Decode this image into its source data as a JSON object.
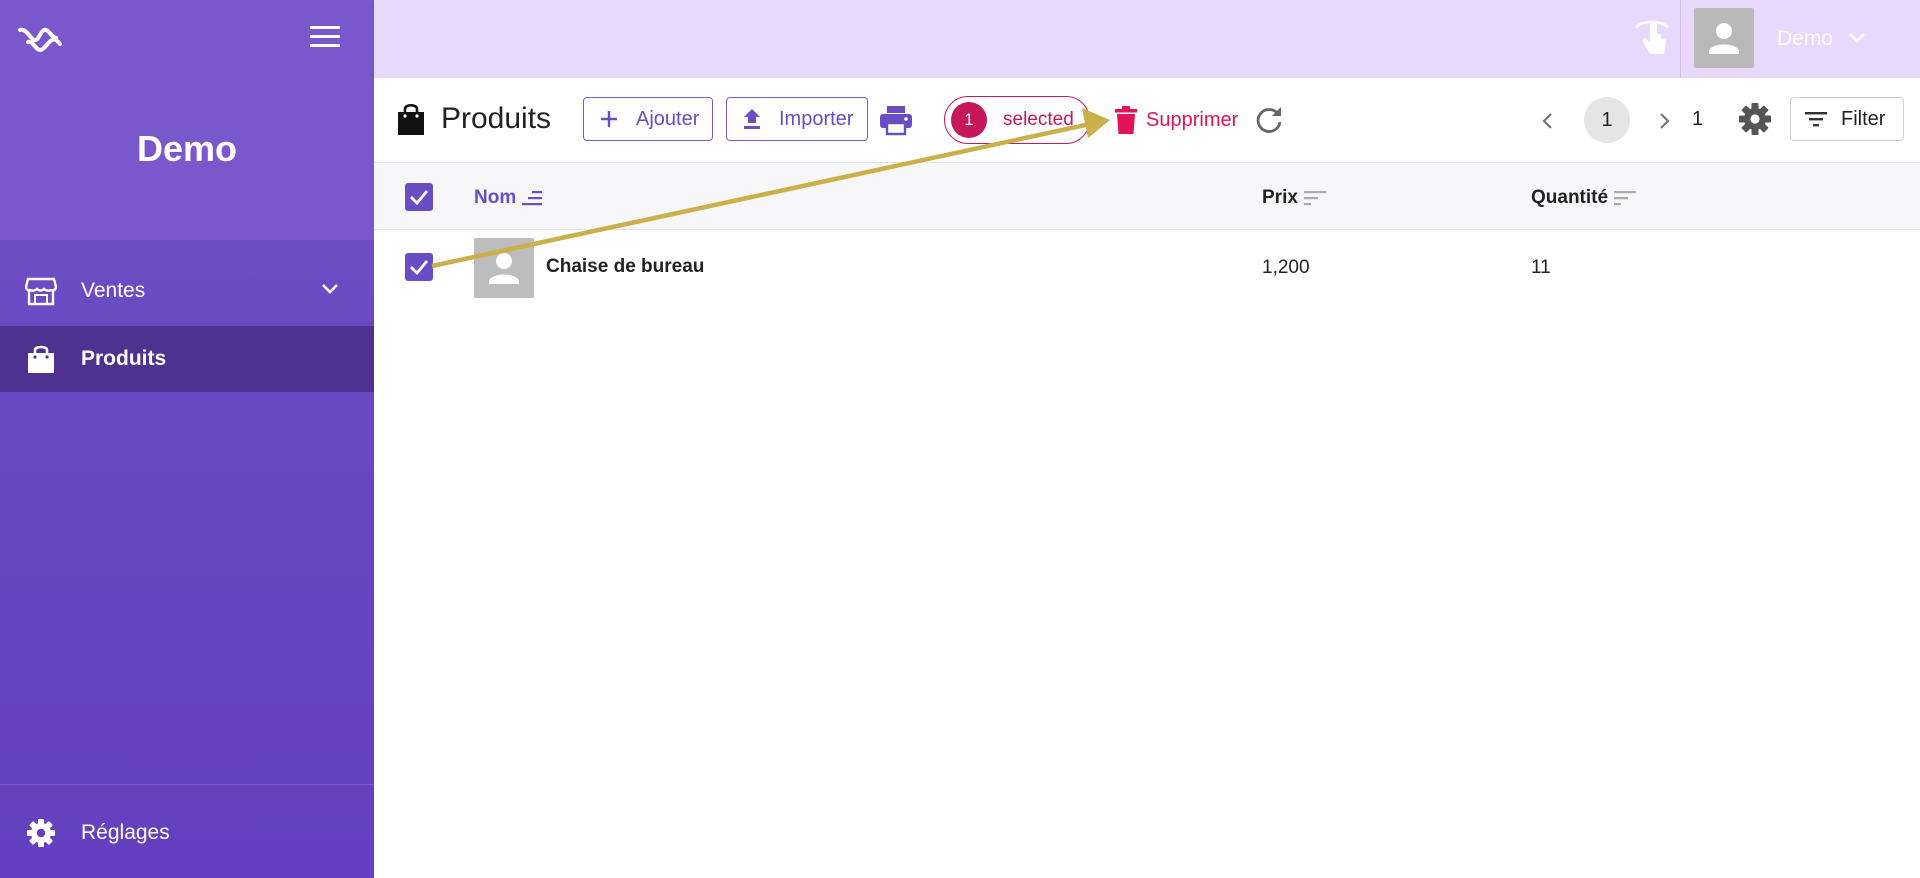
{
  "app": {
    "title": "Demo",
    "accent_color": "#6a4cc4",
    "sidebar_color": "#7a58cc",
    "topbar_color": "#e8d8fc",
    "danger_color": "#e11459"
  },
  "sidebar": {
    "logo_icon": "brand-logo-icon",
    "menu_icon": "hamburger-menu-icon",
    "items": [
      {
        "label": "Ventes",
        "icon": "store-icon",
        "expandable": true
      },
      {
        "label": "Produits",
        "icon": "shopping-bag-icon",
        "active": true
      }
    ],
    "footer": {
      "label": "Réglages",
      "icon": "gear-icon"
    }
  },
  "topbar": {
    "touch_icon": "touch-mode-icon",
    "user_name": "Demo",
    "avatar_icon": "user-avatar-icon"
  },
  "toolbar": {
    "title": "Produits",
    "add_label": "Ajouter",
    "import_label": "Importer",
    "print_icon": "printer-icon",
    "selected_count": "1",
    "selected_label": "selected",
    "delete_label": "Supprimer",
    "refresh_icon": "refresh-icon",
    "pagination": {
      "current": "1",
      "total": "1"
    },
    "settings_icon": "gear-icon",
    "filter_label": "Filter"
  },
  "table": {
    "all_selected": true,
    "columns": [
      {
        "label": "Nom",
        "sorted": true
      },
      {
        "label": "Prix",
        "sorted": false
      },
      {
        "label": "Quantité",
        "sorted": false
      }
    ],
    "rows": [
      {
        "selected": true,
        "name": "Chaise de bureau",
        "prix": "1,200",
        "quantite": "11"
      }
    ]
  },
  "annotation": {
    "color": "#c9b04a",
    "from": "row-checkbox",
    "to": "delete-button"
  }
}
